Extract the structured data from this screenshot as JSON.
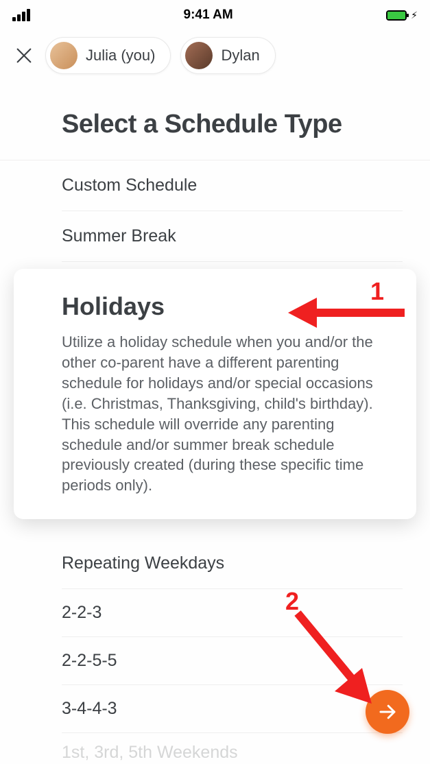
{
  "status": {
    "time": "9:41 AM"
  },
  "header": {
    "people": [
      {
        "label": "Julia (you)"
      },
      {
        "label": "Dylan"
      }
    ]
  },
  "page_title": "Select a Schedule Type",
  "options": {
    "custom": "Custom Schedule",
    "summer": "Summer Break",
    "holidays": {
      "title": "Holidays",
      "description": "Utilize a holiday schedule when you and/or the other co-parent have a different parenting schedule for holidays and/or special occasions (i.e. Christmas, Thanksgiving, child's birthday). This schedule will override any parenting schedule and/or summer break schedule previously created (during these specific time periods only)."
    },
    "repeating": "Repeating Weekdays",
    "patterns": [
      "2-2-3",
      "2-2-5-5",
      "3-4-4-3"
    ],
    "cutoff": "1st, 3rd, 5th Weekends"
  },
  "annotations": {
    "num1": "1",
    "num2": "2"
  },
  "colors": {
    "accent": "#f26a1e",
    "annotation": "#ef2020"
  }
}
